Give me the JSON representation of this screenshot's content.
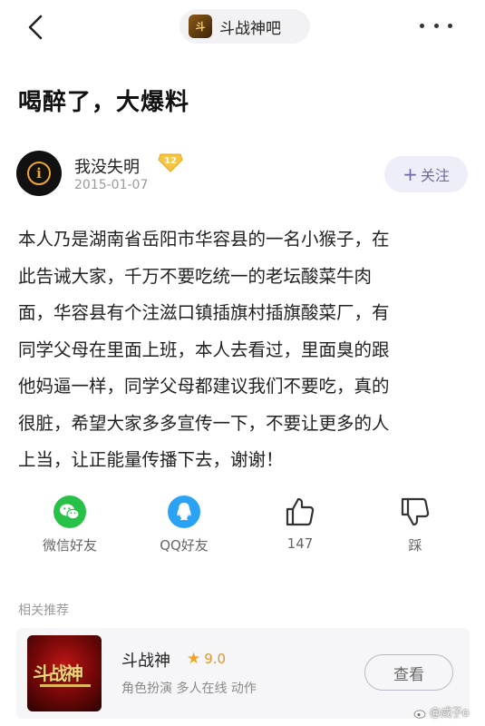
{
  "header": {
    "forum_name": "斗战神吧",
    "forum_logo_text": "斗",
    "back_icon": "chevron-left-icon",
    "more_icon": "more-horizontal-icon"
  },
  "post": {
    "title": "喝醉了，大爆料",
    "author": {
      "name": "我没失明",
      "level": "12",
      "avatar_letter": "i"
    },
    "date": "2015-01-07",
    "follow_label": "关注",
    "body_lines": [
      "本人乃是湖南省岳阳市华容县的一名小猴子，在",
      "此告诫大家，千万不要吃统一的老坛酸菜牛肉",
      "面，华容县有个注滋口镇插旗村插旗酸菜厂，有",
      "同学父母在里面上班，本人去看过，里面臭的跟",
      "他妈逼一样，同学父母都建议我们不要吃，真的",
      "很脏，希望大家多多宣传一下，不要让更多的人",
      "上当，让正能量传播下去，谢谢！"
    ]
  },
  "actions": {
    "wechat_label": "微信好友",
    "qq_label": "QQ好友",
    "like_count": "147",
    "dislike_label": "踩"
  },
  "related": {
    "header": "相关推荐",
    "game": {
      "name": "斗战神",
      "rating": "9.0",
      "tags": "角色扮演  多人在线  动作",
      "thumb_text": "斗战神",
      "view_label": "查看"
    }
  },
  "watermark": "@咸子o",
  "colors": {
    "wechat": "#26c146",
    "qq": "#2aa3f5",
    "star": "#f3a322",
    "badge": "#f3b62c",
    "follow_bg": "#eeeef8"
  }
}
